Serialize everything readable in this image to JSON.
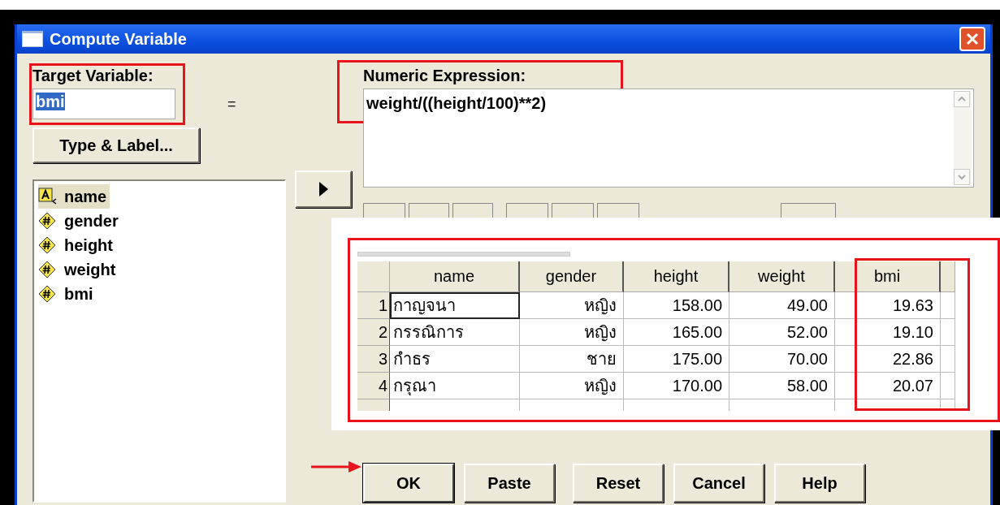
{
  "window": {
    "title": "Compute Variable"
  },
  "target_variable": {
    "label": "Target Variable:",
    "value": "bmi",
    "highlighted": true
  },
  "equals": "=",
  "type_label_button": "Type & Label...",
  "variables": [
    {
      "name": "name",
      "kind": "string",
      "selected": true
    },
    {
      "name": "gender",
      "kind": "numeric",
      "selected": false
    },
    {
      "name": "height",
      "kind": "numeric",
      "selected": false
    },
    {
      "name": "weight",
      "kind": "numeric",
      "selected": false
    },
    {
      "name": "bmi",
      "kind": "numeric",
      "selected": false
    }
  ],
  "numeric_expression": {
    "label": "Numeric Expression:",
    "value": "weight/((height/100)**2)",
    "highlighted": true
  },
  "data_view": {
    "highlighted": true,
    "columns": [
      {
        "label": "name",
        "highlighted": false
      },
      {
        "label": "gender",
        "highlighted": false
      },
      {
        "label": "height",
        "highlighted": false
      },
      {
        "label": "weight",
        "highlighted": false
      },
      {
        "label": "bmi",
        "highlighted": true
      }
    ],
    "rows": [
      {
        "number": "1",
        "focused": true,
        "cells": [
          "กาญจนา",
          "หญิง",
          "158.00",
          "49.00",
          "19.63"
        ]
      },
      {
        "number": "2",
        "focused": false,
        "cells": [
          "กรรณิการ",
          "หญิง",
          "165.00",
          "52.00",
          "19.10"
        ]
      },
      {
        "number": "3",
        "focused": false,
        "cells": [
          "กำธร",
          "ชาย",
          "175.00",
          "70.00",
          "22.86"
        ]
      },
      {
        "number": "4",
        "focused": false,
        "cells": [
          "กรุณา",
          "หญิง",
          "170.00",
          "58.00",
          "20.07"
        ]
      }
    ]
  },
  "buttons": [
    {
      "label": "OK",
      "pointed": true
    },
    {
      "label": "Paste",
      "pointed": false
    },
    {
      "label": "Reset",
      "pointed": false
    },
    {
      "label": "Cancel",
      "pointed": false
    },
    {
      "label": "Help",
      "pointed": false
    }
  ]
}
